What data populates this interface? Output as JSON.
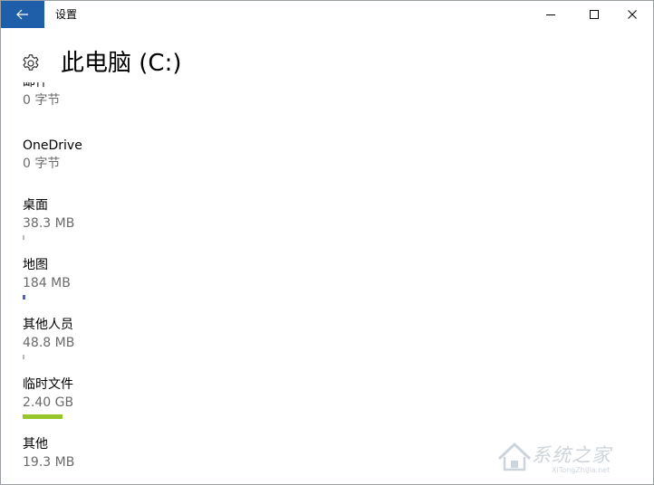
{
  "window": {
    "title": "设置",
    "accent_color": "#1f5fa9"
  },
  "controls": {
    "back_icon": "back-arrow-icon",
    "minimize_icon": "minimize-icon",
    "maximize_icon": "maximize-icon",
    "close_icon": "close-icon"
  },
  "header": {
    "icon": "gear-icon",
    "title": "此电脑 (C:)"
  },
  "items": [
    {
      "label": "邮件",
      "size": "0 字节",
      "usage_fraction": 0,
      "bar_color": ""
    },
    {
      "label": "OneDrive",
      "size": "0 字节",
      "usage_fraction": 0,
      "bar_color": ""
    },
    {
      "label": "桌面",
      "size": "38.3 MB",
      "usage_fraction": 0.003,
      "bar_color": "#b8b8b8"
    },
    {
      "label": "地图",
      "size": "184 MB",
      "usage_fraction": 0.008,
      "bar_color": "#4c62c7"
    },
    {
      "label": "其他人员",
      "size": "48.8 MB",
      "usage_fraction": 0.003,
      "bar_color": "#b8b8b8"
    },
    {
      "label": "临时文件",
      "size": "2.40 GB",
      "usage_fraction": 0.11,
      "bar_color": "#97c62a"
    },
    {
      "label": "其他",
      "size": "19.3 MB",
      "usage_fraction": 0,
      "bar_color": ""
    }
  ],
  "watermark": {
    "text": "系统之家",
    "url": "XiTongZhiJia.net"
  }
}
